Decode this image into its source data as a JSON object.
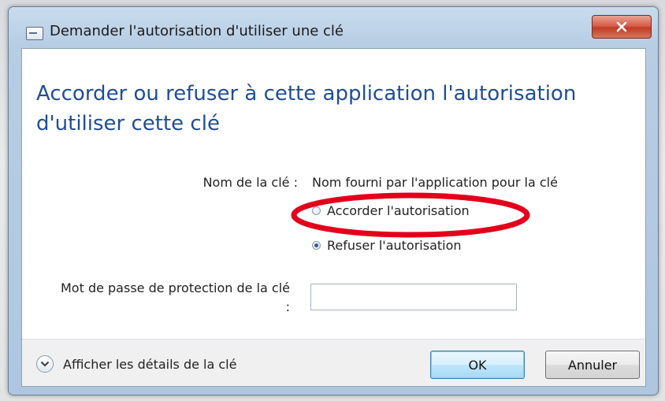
{
  "window": {
    "title": "Demander l'autorisation d'utiliser une clé",
    "close_icon": "close-x-icon"
  },
  "main": {
    "heading": "Accorder ou refuser à cette application l'autorisation d'utiliser cette clé",
    "key_name_label": "Nom de la clé :",
    "key_name_value": "Nom fourni par l'application pour la clé",
    "grant_label": "Accorder l'autorisation",
    "deny_label": "Refuser l'autorisation",
    "selected": "deny",
    "password_label": "Mot de passe de protection de la clé :",
    "password_value": ""
  },
  "footer": {
    "details_label": "Afficher les détails de la clé",
    "ok_label": "OK",
    "cancel_label": "Annuler"
  },
  "colors": {
    "heading": "#1f4e94",
    "annotation": "#e3001b",
    "close_button": "#c9412a"
  }
}
